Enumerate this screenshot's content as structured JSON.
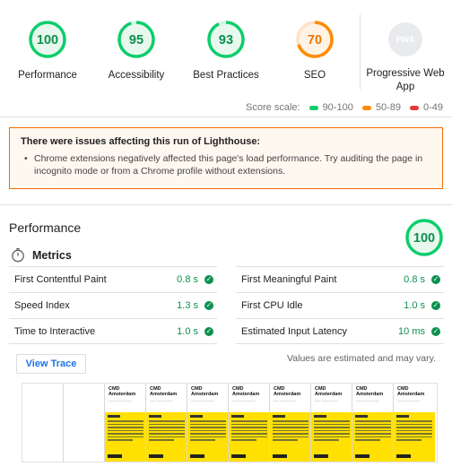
{
  "categories": [
    {
      "label": "Performance",
      "score": "100",
      "value": 100,
      "color": "#0cce6b",
      "text_color": "#0d904f"
    },
    {
      "label": "Accessibility",
      "score": "95",
      "value": 95,
      "color": "#0cce6b",
      "text_color": "#0d904f"
    },
    {
      "label": "Best Practices",
      "score": "93",
      "value": 93,
      "color": "#0cce6b",
      "text_color": "#0d904f"
    },
    {
      "label": "SEO",
      "score": "70",
      "value": 70,
      "color": "#ff8a00",
      "text_color": "#e67700"
    },
    {
      "label": "Progressive Web App",
      "score": "PWA",
      "icon": "pwa-badge-icon"
    }
  ],
  "score_scale": {
    "label": "Score scale:",
    "ranges": [
      {
        "text": "90-100",
        "color": "#0cce6b"
      },
      {
        "text": "50-89",
        "color": "#ff8a00"
      },
      {
        "text": "0-49",
        "color": "#e53935"
      }
    ]
  },
  "warning": {
    "title": "There were issues affecting this run of Lighthouse:",
    "items": [
      "Chrome extensions negatively affected this page's load performance. Try auditing the page in incognito mode or from a Chrome profile without extensions."
    ]
  },
  "performance": {
    "title": "Performance",
    "score": "100",
    "score_value": 100,
    "metrics_title": "Metrics",
    "metrics_icon": "stopwatch-icon",
    "metrics": [
      {
        "name": "First Contentful Paint",
        "value": "0.8 s"
      },
      {
        "name": "First Meaningful Paint",
        "value": "0.8 s"
      },
      {
        "name": "Speed Index",
        "value": "1.3 s"
      },
      {
        "name": "First CPU Idle",
        "value": "1.0 s"
      },
      {
        "name": "Time to Interactive",
        "value": "1.0 s"
      },
      {
        "name": "Estimated Input Latency",
        "value": "10 ms"
      }
    ],
    "view_trace_label": "View Trace",
    "estimate_note": "Values are estimated and may vary."
  },
  "filmstrip": {
    "frame_title": "CMD Amsterdam",
    "blank_frames": 2,
    "filled_frames": 8
  }
}
